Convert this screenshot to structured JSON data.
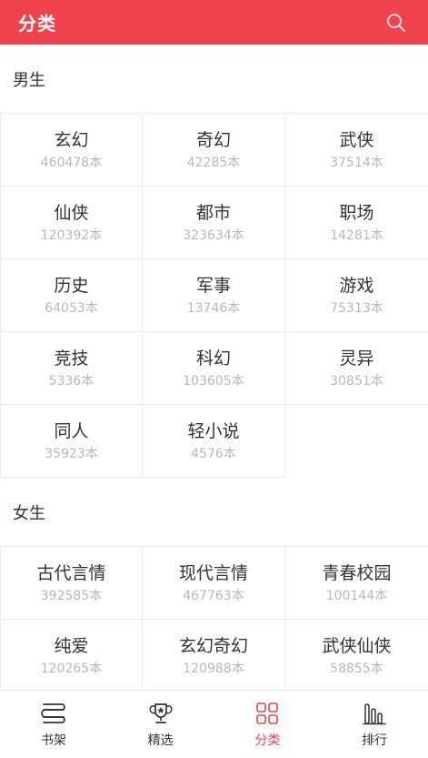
{
  "header": {
    "title": "分类"
  },
  "sections": [
    {
      "title": "男生",
      "items": [
        {
          "name": "玄幻",
          "count": "460478本"
        },
        {
          "name": "奇幻",
          "count": "42285本"
        },
        {
          "name": "武侠",
          "count": "37514本"
        },
        {
          "name": "仙侠",
          "count": "120392本"
        },
        {
          "name": "都市",
          "count": "323634本"
        },
        {
          "name": "职场",
          "count": "14281本"
        },
        {
          "name": "历史",
          "count": "64053本"
        },
        {
          "name": "军事",
          "count": "13746本"
        },
        {
          "name": "游戏",
          "count": "75313本"
        },
        {
          "name": "竞技",
          "count": "5336本"
        },
        {
          "name": "科幻",
          "count": "103605本"
        },
        {
          "name": "灵异",
          "count": "30851本"
        },
        {
          "name": "同人",
          "count": "35923本"
        },
        {
          "name": "轻小说",
          "count": "4576本"
        }
      ]
    },
    {
      "title": "女生",
      "items": [
        {
          "name": "古代言情",
          "count": "392585本"
        },
        {
          "name": "现代言情",
          "count": "467763本"
        },
        {
          "name": "青春校园",
          "count": "100144本"
        },
        {
          "name": "纯爱",
          "count": "120265本"
        },
        {
          "name": "玄幻奇幻",
          "count": "120988本"
        },
        {
          "name": "武侠仙侠",
          "count": "58855本"
        }
      ]
    }
  ],
  "tabbar": {
    "items": [
      {
        "label": "书架",
        "icon": "bookshelf-icon"
      },
      {
        "label": "精选",
        "icon": "trophy-icon"
      },
      {
        "label": "分类",
        "icon": "grid-icon",
        "active": true
      },
      {
        "label": "排行",
        "icon": "ranking-icon"
      }
    ]
  },
  "colors": {
    "accent": "#f0434d",
    "count_text": "#b8b8b8",
    "border": "#ececec"
  }
}
